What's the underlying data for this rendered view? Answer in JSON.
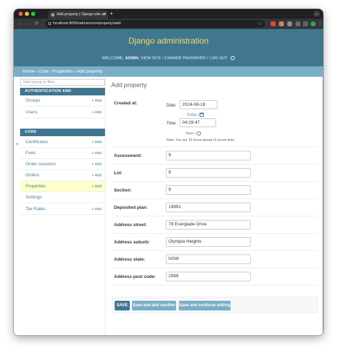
{
  "browser": {
    "tab_title": "Add property | Django site ad",
    "tab_close": "×",
    "new_tab": "+",
    "menu": "⌄",
    "url": "localhost:8000/admin/core/property/add/",
    "back": "←",
    "forward": "→",
    "reload": "⟳",
    "bookmark": "☆",
    "colors": {
      "frame": "#202124",
      "toolbar": "#35363a"
    }
  },
  "header": {
    "site_name": "Django administration",
    "welcome": "WELCOME,",
    "username": "ADMIN.",
    "view_site": "VIEW SITE",
    "change_password": "CHANGE PASSWORD",
    "log_out": "LOG OUT",
    "separator": "/",
    "colors": {
      "header_bg": "#417690",
      "site_name": "#f5dd5d",
      "breadcrumbs_bg": "#79aec8"
    }
  },
  "breadcrumbs": {
    "home": "Home",
    "app": "Core",
    "model": "Properties",
    "current": "Add property",
    "sep": "›"
  },
  "sidebar": {
    "filter_placeholder": "Start typing to filter...",
    "collapse": "«",
    "add_label": "Add",
    "add_icon": "+",
    "auth_caption": "AUTHENTICATION AND AUTHORIZATION",
    "auth_items": [
      {
        "label": "Groups"
      },
      {
        "label": "Users"
      }
    ],
    "core_caption": "CORE",
    "core_items": [
      {
        "label": "Certificates"
      },
      {
        "label": "Fees"
      },
      {
        "label": "Order sessions"
      },
      {
        "label": "Orders"
      },
      {
        "label": "Properties"
      },
      {
        "label": "Settings"
      },
      {
        "label": "Tax Rates"
      }
    ]
  },
  "form": {
    "title": "Add property",
    "created_at": {
      "label": "Created at:",
      "date_label": "Date:",
      "date_value": "2024-08-18",
      "today": "Today",
      "time_label": "Time:",
      "time_value": "04:29:47",
      "now": "Now",
      "pipe": "|",
      "help": "Note: You are 10 hours ahead of server time."
    },
    "fields": [
      {
        "label": "Assessment:",
        "value": "9"
      },
      {
        "label": "Lot:",
        "value": "9"
      },
      {
        "label": "Section:",
        "value": "9"
      },
      {
        "label": "Deposited plan:",
        "value": "19991"
      },
      {
        "label": "Address street:",
        "value": "78 Everglade Drive"
      },
      {
        "label": "Address suburb:",
        "value": "Olympia Heights"
      },
      {
        "label": "Address state:",
        "value": "NSW"
      },
      {
        "label": "Address post code:",
        "value": "2999"
      }
    ],
    "buttons": {
      "save": "SAVE",
      "save_add_another": "Save and add another",
      "save_continue": "Save and continue editing"
    }
  }
}
